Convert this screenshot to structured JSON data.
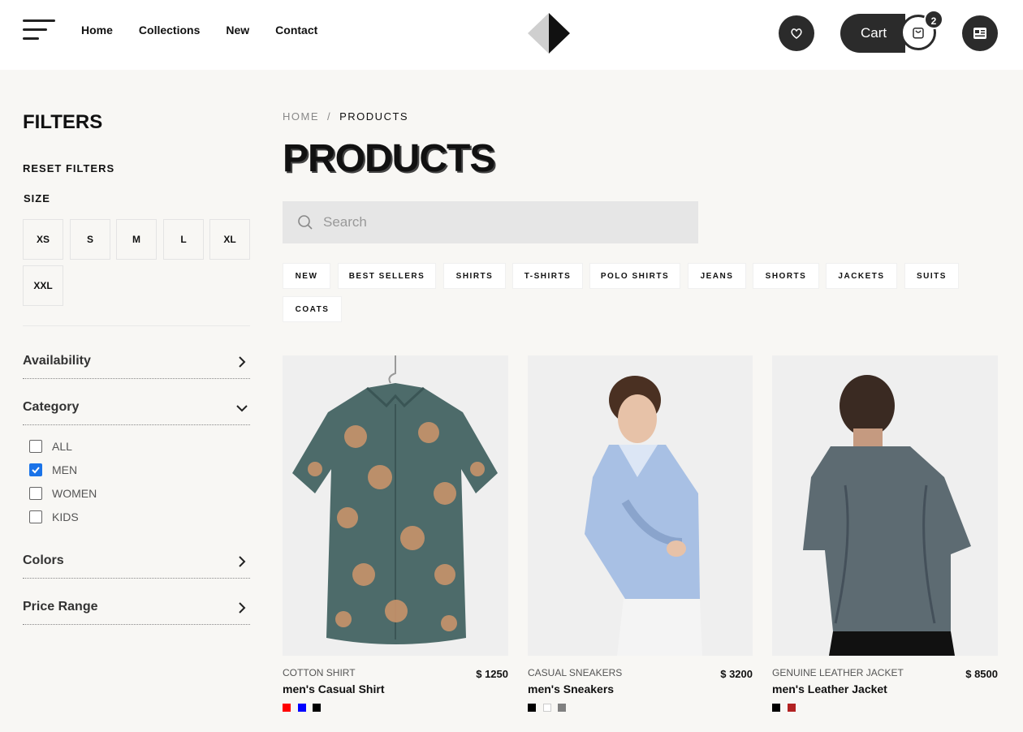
{
  "nav": {
    "items": [
      "Home",
      "Collections",
      "New",
      "Contact"
    ]
  },
  "cart": {
    "label": "Cart",
    "count": "2"
  },
  "sidebar": {
    "title": "FILTERS",
    "reset": "RESET FILTERS",
    "size_label": "SIZE",
    "sizes": [
      "XS",
      "S",
      "M",
      "L",
      "XL",
      "XXL"
    ],
    "sections": {
      "availability": "Availability",
      "category": "Category",
      "colors": "Colors",
      "price": "Price Range"
    },
    "categories": [
      {
        "label": "ALL",
        "checked": false
      },
      {
        "label": "MEN",
        "checked": true
      },
      {
        "label": "WOMEN",
        "checked": false
      },
      {
        "label": "KIDS",
        "checked": false
      }
    ]
  },
  "breadcrumb": {
    "home": "HOME",
    "sep": "/",
    "current": "PRODUCTS"
  },
  "page_title": "PRODUCTS",
  "search": {
    "placeholder": "Search"
  },
  "chips": [
    "NEW",
    "BEST SELLERS",
    "SHIRTS",
    "T-SHIRTS",
    "POLO SHIRTS",
    "JEANS",
    "SHORTS",
    "JACKETS",
    "SUITS",
    "COATS"
  ],
  "products": [
    {
      "sub": "COTTON SHIRT",
      "name": "men's Casual Shirt",
      "price": "$ 1250",
      "colors": [
        "#ff0000",
        "#0000ff",
        "#000000"
      ]
    },
    {
      "sub": "CASUAL SNEAKERS",
      "name": "men's Sneakers",
      "price": "$ 3200",
      "colors": [
        "#000000",
        "#ffffff",
        "#808080"
      ]
    },
    {
      "sub": "GENUINE LEATHER JACKET",
      "name": "men's Leather Jacket",
      "price": "$ 8500",
      "colors": [
        "#000000",
        "#b22222"
      ]
    }
  ]
}
